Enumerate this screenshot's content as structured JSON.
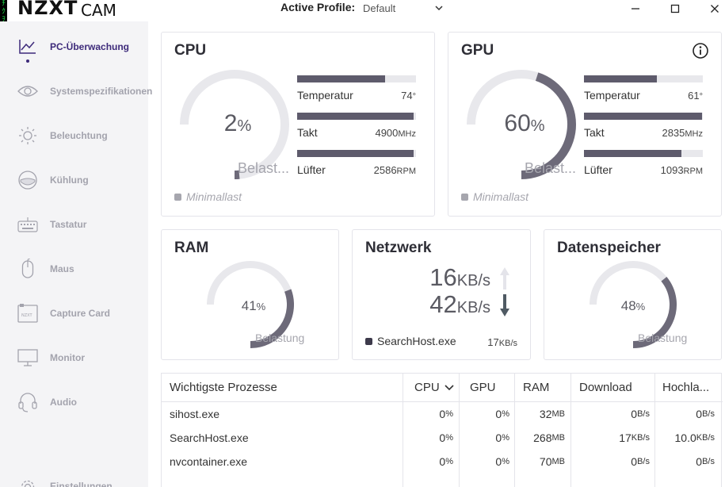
{
  "app": {
    "logo": "NZXT",
    "logo_suffix": "CAM",
    "profile_label": "Active Profile:",
    "profile_value": "Default"
  },
  "sidebar": {
    "items": [
      {
        "label": "PC-Überwachung",
        "icon": "monitoring-chart-icon",
        "active": true
      },
      {
        "label": "Systemspezifikationen",
        "icon": "eye-icon",
        "active": false
      },
      {
        "label": "Beleuchtung",
        "icon": "sun-icon",
        "active": false
      },
      {
        "label": "Kühlung",
        "icon": "cooling-icon",
        "active": false
      },
      {
        "label": "Tastatur",
        "icon": "keyboard-icon",
        "active": false
      },
      {
        "label": "Maus",
        "icon": "mouse-icon",
        "active": false
      },
      {
        "label": "Capture Card",
        "icon": "capture-card-icon",
        "active": false
      },
      {
        "label": "Monitor",
        "icon": "monitor-icon",
        "active": false
      },
      {
        "label": "Audio",
        "icon": "headset-icon",
        "active": false
      }
    ],
    "settings_label": "Einstellungen"
  },
  "cpu": {
    "title": "CPU",
    "load": "2",
    "load_unit": "%",
    "load_fraction": 0.02,
    "load_label": "Belast...",
    "state": "Minimallast",
    "stats": [
      {
        "name": "Temperatur",
        "value": "74",
        "unit": "°",
        "fill": 0.74
      },
      {
        "name": "Takt",
        "value": "4900",
        "unit": "MHz",
        "fill": 0.98
      },
      {
        "name": "Lüfter",
        "value": "2586",
        "unit": "RPM",
        "fill": 0.98
      }
    ]
  },
  "gpu": {
    "title": "GPU",
    "load": "60",
    "load_unit": "%",
    "load_fraction": 0.6,
    "load_label": "Belast...",
    "state": "Minimallast",
    "stats": [
      {
        "name": "Temperatur",
        "value": "61",
        "unit": "°",
        "fill": 0.61
      },
      {
        "name": "Takt",
        "value": "2835",
        "unit": "MHz",
        "fill": 0.99
      },
      {
        "name": "Lüfter",
        "value": "1093",
        "unit": "RPM",
        "fill": 0.82
      }
    ]
  },
  "ram": {
    "title": "RAM",
    "load": "41",
    "load_unit": "%",
    "load_fraction": 0.41,
    "load_label": "Belastung"
  },
  "network": {
    "title": "Netzwerk",
    "up_value": "16",
    "up_unit": "KB/s",
    "down_value": "42",
    "down_unit": "KB/s",
    "top_process": "SearchHost.exe",
    "top_value": "17",
    "top_unit": "KB/s"
  },
  "storage": {
    "title": "Datenspeicher",
    "load": "48",
    "load_unit": "%",
    "load_fraction": 0.48,
    "load_label": "Belastung"
  },
  "processes": {
    "headers": [
      "Wichtigste Prozesse",
      "CPU",
      "GPU",
      "RAM",
      "Download",
      "Hochla..."
    ],
    "rows": [
      {
        "name": "sihost.exe",
        "cpu": "0",
        "gpu": "0",
        "ram": "32",
        "down": "0",
        "up": "0"
      },
      {
        "name": "SearchHost.exe",
        "cpu": "0",
        "gpu": "0",
        "ram": "268",
        "down": "17",
        "up": "10.0"
      },
      {
        "name": "nvcontainer.exe",
        "cpu": "0",
        "gpu": "0",
        "ram": "70",
        "down": "0",
        "up": "0"
      }
    ],
    "units": {
      "percent": "%",
      "ram": "MB",
      "rate": "B/s",
      "krate": "KB/s"
    }
  },
  "colors": {
    "accent": "#3d2a7a",
    "gauge_fill": "#6d6a79",
    "gauge_track": "#e8e8ec",
    "matrix_green": "#1ee84a"
  }
}
